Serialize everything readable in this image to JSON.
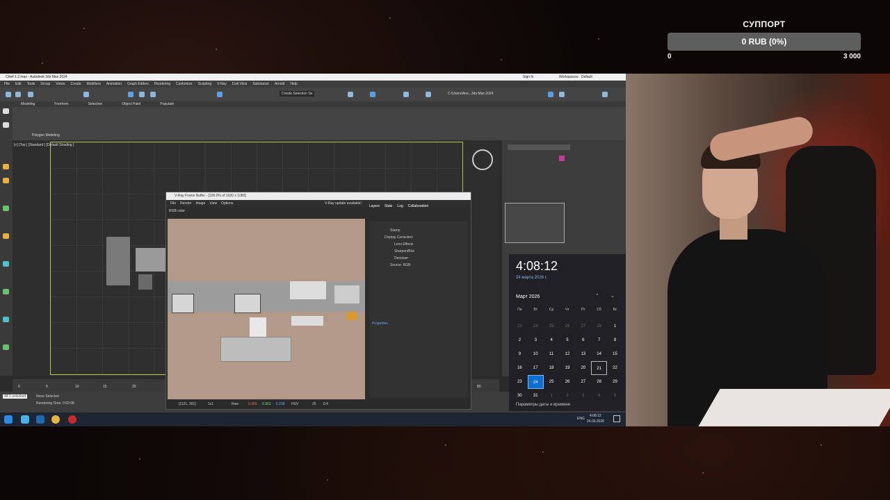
{
  "donation": {
    "title": "СУППОРТ",
    "value": "0 RUB (0%)",
    "min": "0",
    "max": "3 000",
    "progress_fraction": 0
  },
  "app": {
    "window_title": "Chief 1.2.max - Autodesk 3ds Max 2024",
    "menu": [
      "File",
      "Edit",
      "Tools",
      "Group",
      "Views",
      "Create",
      "Modifiers",
      "Animation",
      "Graph Editors",
      "Rendering",
      "Customize",
      "Scripting",
      "V-Ray",
      "Civil View",
      "Substance",
      "Arnold",
      "Help"
    ],
    "sign_in": "Sign In",
    "workspaces_label": "Workspaces:",
    "workspace": "Default",
    "create_selection_set": "Create Selection Se",
    "path": "C:\\Users\\Ane...3ds Max 2024",
    "ribbon_tabs": [
      "Modeling",
      "Freeform",
      "Selection",
      "Object Paint",
      "Populate"
    ],
    "polygon_modeling": "Polygon Modeling",
    "viewport_label": "[+] [Top ] [Standard ] [Default Shading ]",
    "status_none_selected": "None Selected",
    "status_render_time": "Rendering Time: 0:02:08",
    "status_unlocked": "44.1 unlocked",
    "timeline_ticks": [
      "0",
      "5",
      "10",
      "15",
      "20",
      "80"
    ]
  },
  "vfb": {
    "title": "V-Ray Frame Buffer - [100.0% of 1920 x 1080]",
    "menu": [
      "File",
      "Render",
      "Image",
      "View",
      "Options"
    ],
    "update": "V-Ray update available!",
    "channel": "RGB color",
    "tabs": [
      "Layers",
      "Stats",
      "Log",
      "Collaboration"
    ],
    "layers": [
      "Stamp",
      "Display Correction",
      "Lens Effects",
      "Sharpen/Blur",
      "Denoiser",
      "Source: RGB"
    ],
    "properties": "Properties",
    "status_coords": "[1121, 391]",
    "status_zoom": "1x1",
    "status_raw": "Raw",
    "status_v1": "0.369",
    "status_v2": "0.361",
    "status_v3": "0.238",
    "status_hsv": "HSV",
    "status_h": "25",
    "status_s": "0.4"
  },
  "calendar": {
    "time": "4:08:12",
    "date": "24 марта 2026 г.",
    "month": "Март 2026",
    "weekdays": [
      "Пн",
      "Вт",
      "Ср",
      "Чт",
      "Пт",
      "Сб",
      "Вс"
    ],
    "weeks": [
      [
        "23",
        "24",
        "25",
        "26",
        "27",
        "28",
        "1"
      ],
      [
        "2",
        "3",
        "4",
        "5",
        "6",
        "7",
        "8"
      ],
      [
        "9",
        "10",
        "11",
        "12",
        "13",
        "14",
        "15"
      ],
      [
        "16",
        "17",
        "18",
        "19",
        "20",
        "21",
        "22"
      ],
      [
        "23",
        "24",
        "25",
        "26",
        "27",
        "28",
        "29"
      ],
      [
        "30",
        "31",
        "1",
        "2",
        "3",
        "4",
        "5"
      ]
    ],
    "today": "24",
    "footer": "Параметры даты и времени"
  },
  "tray": {
    "lang": "ENG",
    "time": "4:08:12",
    "date": "24.03.2026"
  }
}
